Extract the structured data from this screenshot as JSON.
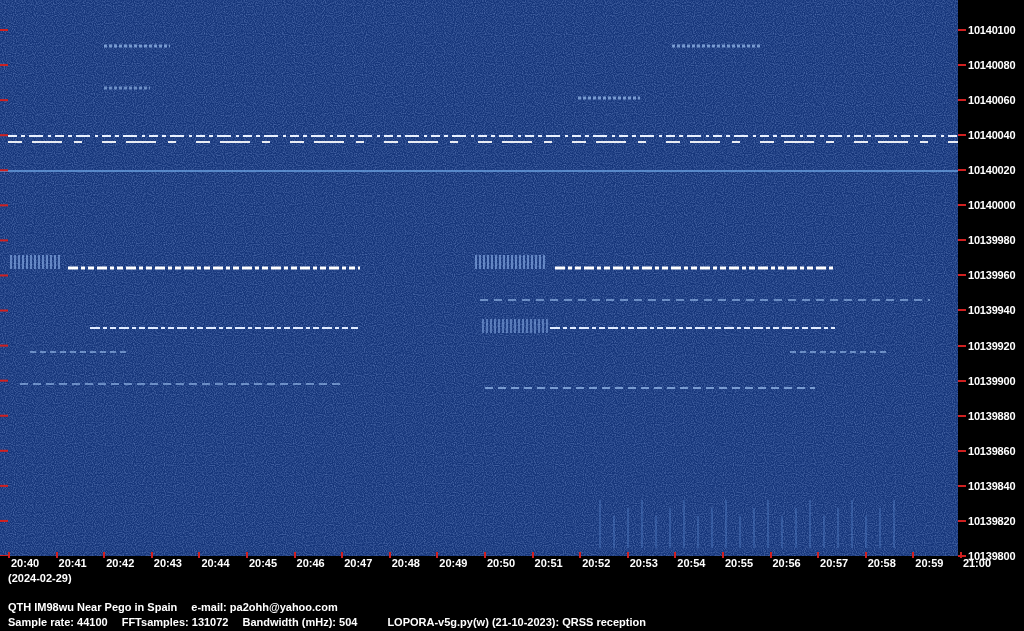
{
  "spectrogram": {
    "frequency_labels": [
      "10140100",
      "10140080",
      "10140060",
      "10140040",
      "10140020",
      "10140000",
      "10139980",
      "10139960",
      "10139940",
      "10139920",
      "10139900",
      "10139880",
      "10139860",
      "10139840",
      "10139820",
      "10139800"
    ],
    "time_labels": [
      "20:40",
      "20:41",
      "20:42",
      "20:43",
      "20:44",
      "20:45",
      "20:46",
      "20:47",
      "20:48",
      "20:49",
      "20:50",
      "20:51",
      "20:52",
      "20:53",
      "20:54",
      "20:55",
      "20:56",
      "20:57",
      "20:58",
      "20:59",
      "21:00"
    ],
    "date": "(2024-02-29)"
  },
  "footer": {
    "line_1": [
      "QTH IM98wu Near Pego in Spain",
      "e-mail: pa2ohh@yahoo.com"
    ],
    "line_2": [
      "Sample rate: 44100",
      "FFTsamples: 131072",
      "Bandwidth (mHz): 504",
      "LOPORA-v5g.py(w) (21-10-2023): QRSS reception"
    ]
  }
}
